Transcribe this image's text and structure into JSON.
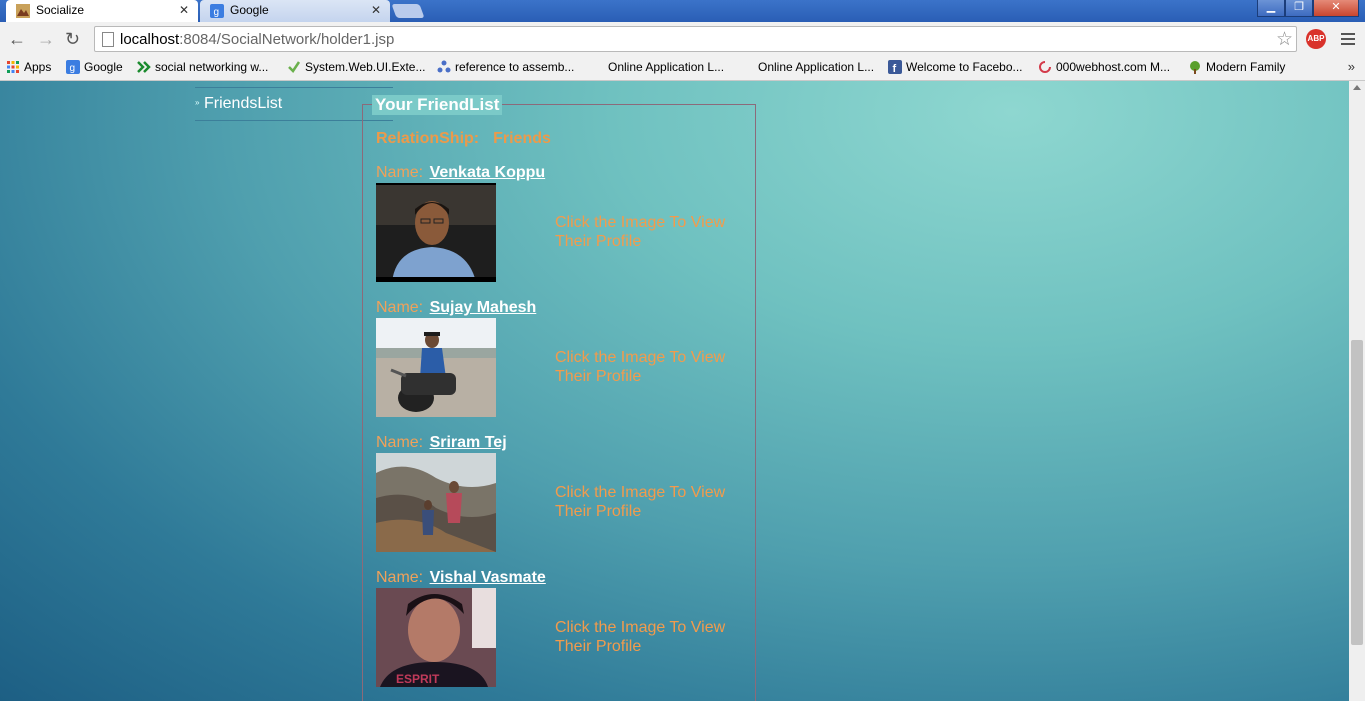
{
  "browser": {
    "tabs": [
      {
        "title": "Socialize",
        "active": true
      },
      {
        "title": "Google",
        "active": false
      }
    ],
    "url_host": "localhost",
    "url_path": ":8084/SocialNetwork/holder1.jsp",
    "abp_label": "ABP",
    "bookmarks": [
      {
        "label": "Apps",
        "icon": "apps-grid-icon"
      },
      {
        "label": "Google",
        "icon": "google-icon"
      },
      {
        "label": "social networking w...",
        "icon": "double-chevron-icon"
      },
      {
        "label": "System.Web.UI.Exte...",
        "icon": "checkmark-icon"
      },
      {
        "label": "reference to assemb...",
        "icon": "molecule-icon"
      },
      {
        "label": "Online Application L...",
        "icon": "none"
      },
      {
        "label": "Online Application L...",
        "icon": "none"
      },
      {
        "label": "Welcome to Facebo...",
        "icon": "facebook-icon"
      },
      {
        "label": "000webhost.com M...",
        "icon": "swirl-icon"
      },
      {
        "label": "Modern Family",
        "icon": "tree-icon"
      }
    ],
    "bookmarks_more": "»"
  },
  "sidebar": {
    "items": [
      {
        "label": "FriendsList"
      }
    ]
  },
  "panel": {
    "legend": "Your FriendList",
    "relationship_label": "RelationShip:",
    "relationship_value": "Friends",
    "name_prefix": "Name:",
    "cta_text": "Click the Image To View Their Profile",
    "friends": [
      {
        "name": "Venkata Koppu"
      },
      {
        "name": "Sujay Mahesh"
      },
      {
        "name": "Sriram Tej"
      },
      {
        "name": "Vishal Vasmate"
      }
    ]
  },
  "colors": {
    "accent_orange": "#f29b4c",
    "page_teal": "#4f9fae",
    "link_white": "#ffffff"
  }
}
